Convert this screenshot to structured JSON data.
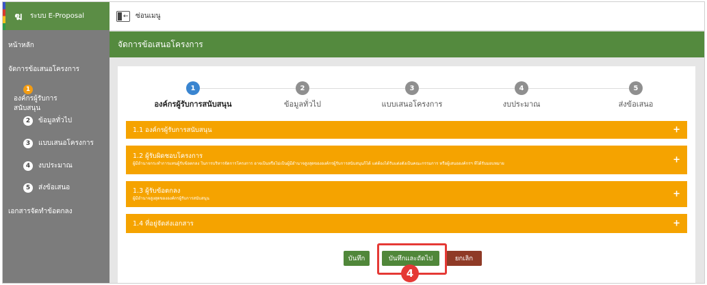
{
  "brand": {
    "logo_glyph": "ฆ",
    "title": "ระบบ E-Proposal"
  },
  "topbar": {
    "toggle_label": "ซ่อนเมนู"
  },
  "sidebar": {
    "items": [
      {
        "label": "หน้าหลัก"
      },
      {
        "label": "จัดการข้อเสนอโครงการ"
      },
      {
        "num": "1",
        "label": "องค์กรผู้รับการสนับสนุน"
      },
      {
        "num": "2",
        "label": "ข้อมูลทั่วไป"
      },
      {
        "num": "3",
        "label": "แบบเสนอโครงการ"
      },
      {
        "num": "4",
        "label": "งบประมาณ"
      },
      {
        "num": "5",
        "label": "ส่งข้อเสนอ"
      },
      {
        "label": "เอกสารจัดทำข้อตกลง"
      }
    ]
  },
  "header": {
    "title": "จัดการข้อเสนอโครงการ"
  },
  "steps": [
    {
      "num": "1",
      "label": "องค์กรผู้รับการสนับสนุน"
    },
    {
      "num": "2",
      "label": "ข้อมูลทั่วไป"
    },
    {
      "num": "3",
      "label": "แบบเสนอโครงการ"
    },
    {
      "num": "4",
      "label": "งบประมาณ"
    },
    {
      "num": "5",
      "label": "ส่งข้อเสนอ"
    }
  ],
  "panels": [
    {
      "title": "1.1 องค์กรผู้รับการสนับสนุน",
      "subtitle": ""
    },
    {
      "title": "1.2 ผู้รับผิดชอบโครงการ",
      "subtitle": "ผู้มีอำนาจกระทำการแทนผู้รับข้อตกลง ในการบริหารจัดการโครงการ อาจเป็นหรือไม่เป็นผู้มีอำนาจสูงสุดขององค์กรผู้รับการสนับสนุนก็ได้ แต่ต้องได้รับแต่งตั้งเป็นคณะกรรมการ หรือผู้เสนอองค์กรฯ ที่ได้รับมอบหมาย"
    },
    {
      "title": "1.3 ผู้รับข้อตกลง",
      "subtitle": "ผู้มีอำนาจสูงสุดขององค์กรผู้รับการสนับสนุน"
    },
    {
      "title": "1.4 ที่อยู่จัดส่งเอกสาร",
      "subtitle": ""
    }
  ],
  "panel_expand_glyph": "+",
  "buttons": {
    "save": "บันทึก",
    "save_next": "บันทึกและถัดไป",
    "cancel": "ยกเลิก"
  },
  "annotation": {
    "badge_number": "4"
  },
  "colors": {
    "accent_green": "#548a3e",
    "panel_orange": "#f5a300",
    "active_step": "#3a85d0",
    "highlight_red": "#e53935"
  }
}
